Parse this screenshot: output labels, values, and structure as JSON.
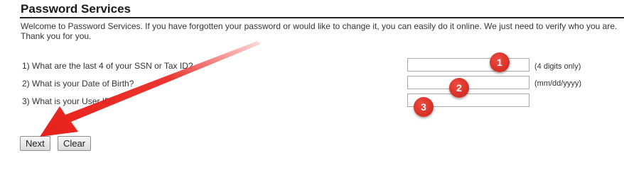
{
  "page": {
    "title": "Password Services",
    "welcome_text": "Welcome to Password Services. If you have forgotten your password or would like to change it, you can easily do it online. We just need to verify who you are. Thank you for you."
  },
  "form": {
    "questions": [
      {
        "label": "1) What are the last 4 of your SSN or Tax ID?",
        "hint": "(4 digits only)",
        "value": ""
      },
      {
        "label": "2) What is your Date of Birth?",
        "hint": "(mm/dd/yyyy)",
        "value": ""
      },
      {
        "label": "3) What is your User ID?",
        "hint": "",
        "value": ""
      }
    ],
    "next_label": "Next",
    "clear_label": "Clear"
  },
  "annotations": {
    "badges": [
      "1",
      "2",
      "3"
    ],
    "arrow_color": "#e8201a",
    "badge_color": "#d92b22"
  }
}
